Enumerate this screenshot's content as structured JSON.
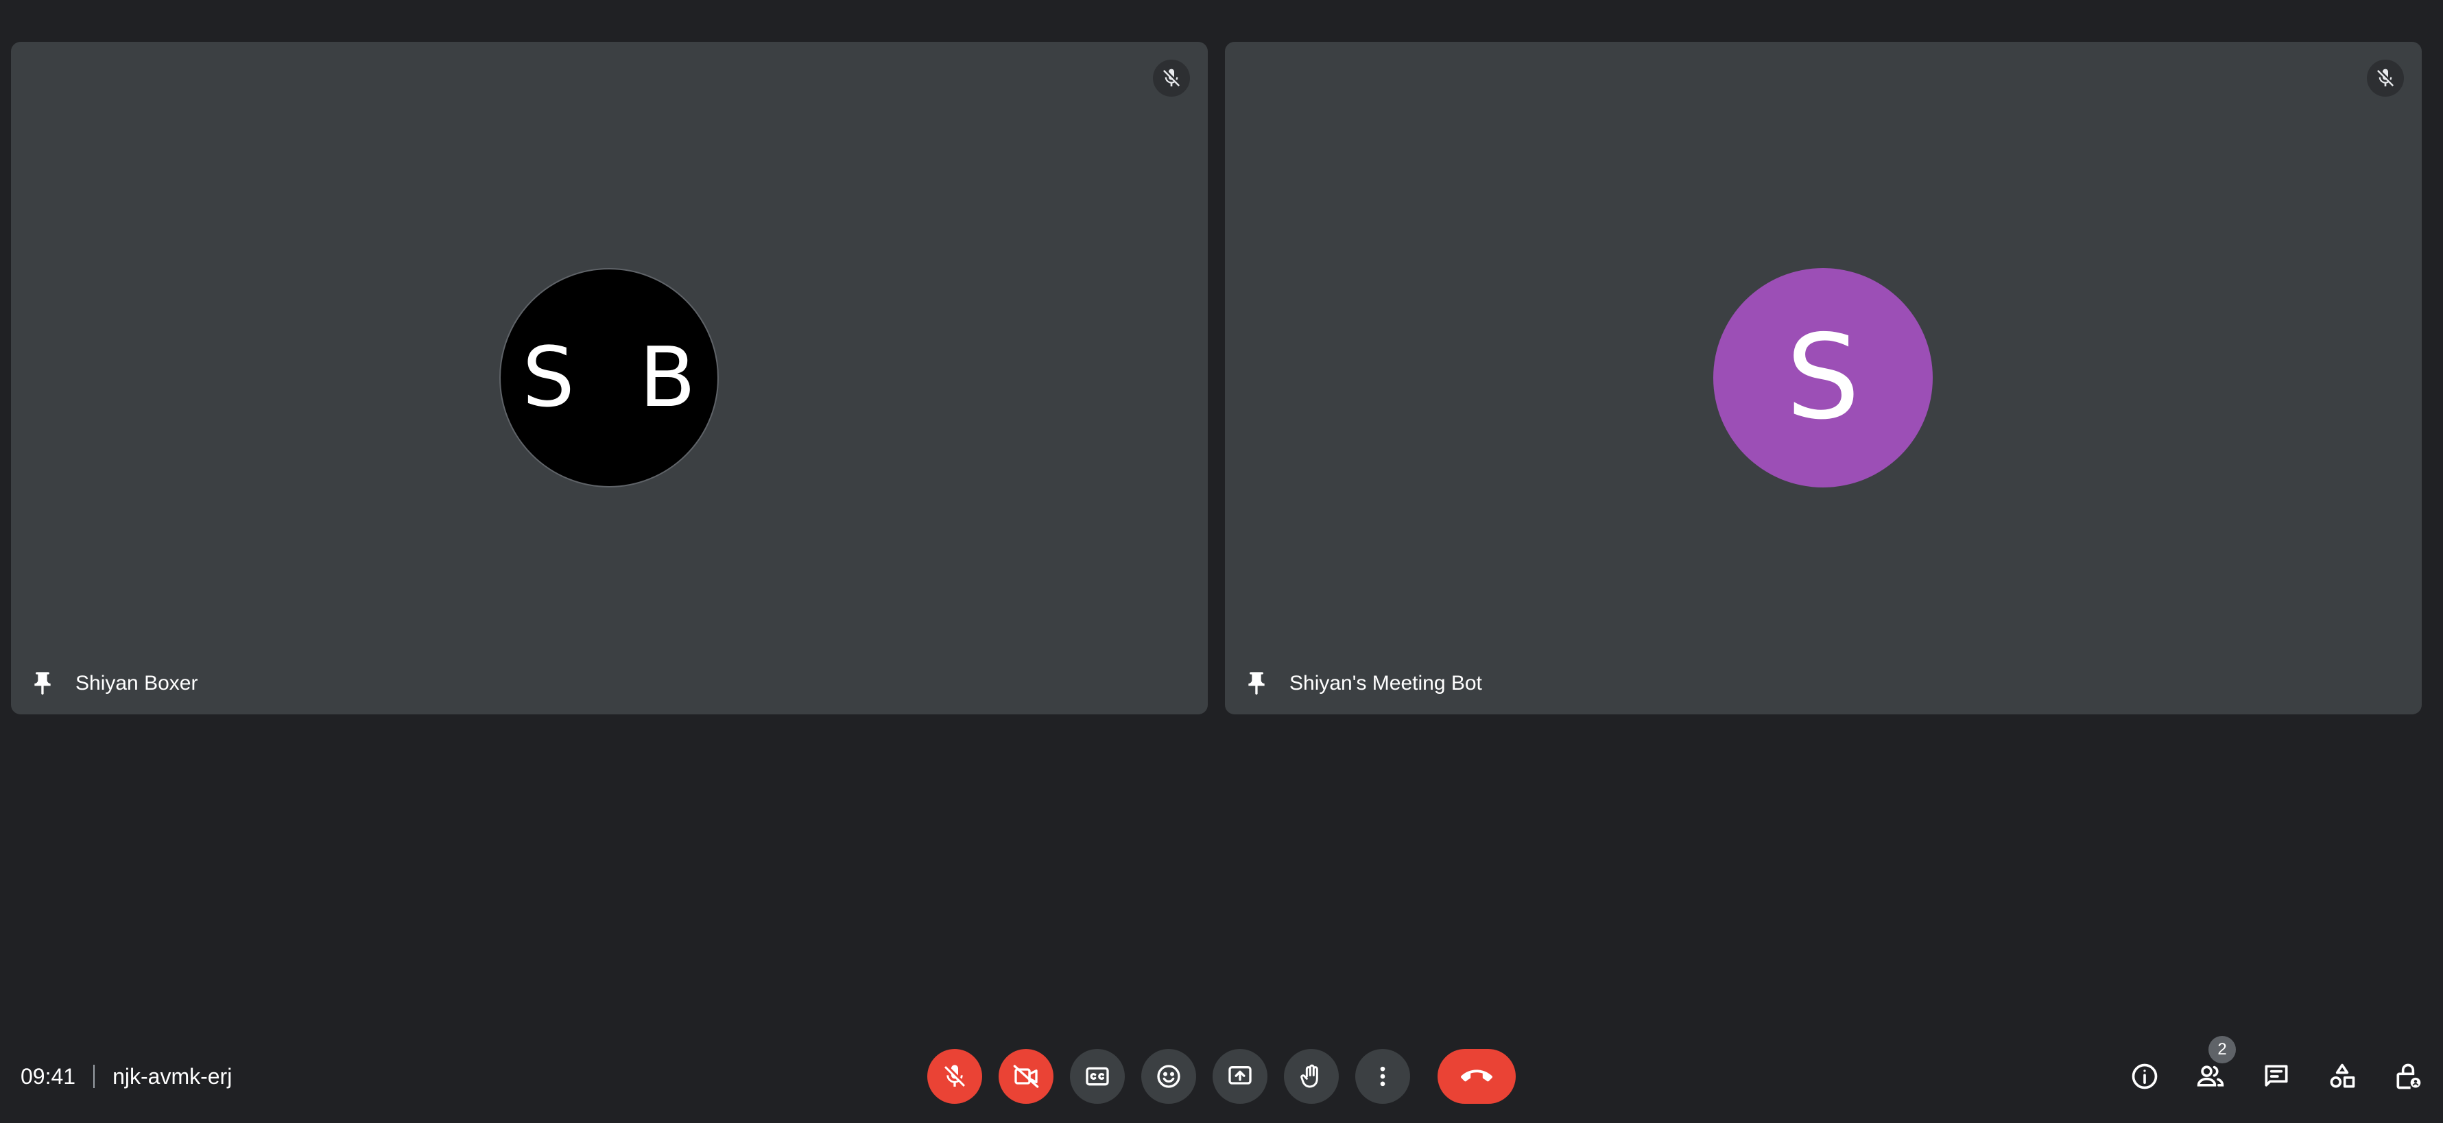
{
  "participants": [
    {
      "name": "Shiyan Boxer",
      "initials": "S B",
      "avatar_color": "#000000",
      "muted": true
    },
    {
      "name": "Shiyan's Meeting Bot",
      "initials": "S",
      "avatar_color": "#9c4fb6",
      "muted": true
    }
  ],
  "meeting": {
    "time": "09:41",
    "code": "njk-avmk-erj"
  },
  "controls": [
    {
      "id": "microphone",
      "icon": "mic-off-icon",
      "state": "off"
    },
    {
      "id": "camera",
      "icon": "videocam-off-icon",
      "state": "off"
    },
    {
      "id": "captions",
      "icon": "closed-caption-icon"
    },
    {
      "id": "reactions",
      "icon": "emoji-icon"
    },
    {
      "id": "present",
      "icon": "present-screen-icon"
    },
    {
      "id": "raise-hand",
      "icon": "hand-icon"
    },
    {
      "id": "more-options",
      "icon": "more-vert-icon"
    },
    {
      "id": "leave-call",
      "icon": "call-end-icon"
    }
  ],
  "side_actions": {
    "people_count": "2"
  },
  "colors": {
    "background": "#202124",
    "tile": "#3c4043",
    "danger": "#ea4335",
    "accent_avatar": "#9c4fb6"
  }
}
